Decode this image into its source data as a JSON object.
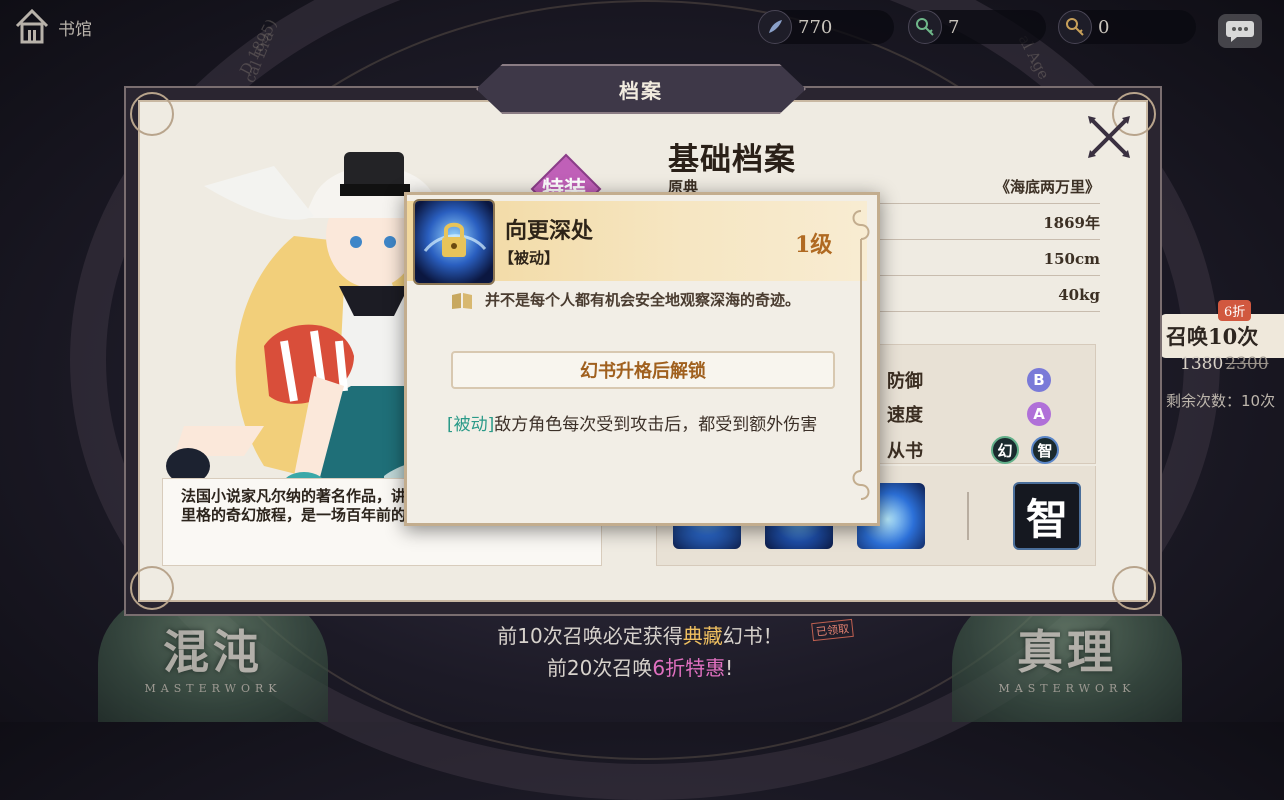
{
  "topbar": {
    "home_label": "书馆",
    "currencies": [
      {
        "icon": "feather-gem-icon",
        "value": "770"
      },
      {
        "icon": "key-icon",
        "value": "7"
      },
      {
        "icon": "golden-key-icon",
        "value": "0"
      }
    ]
  },
  "background": {
    "era_text_left": "cal Era",
    "era_text_left2": "D 1895)",
    "era_text_right": "al Age",
    "summon": {
      "label": "召唤10次",
      "discount": "6折",
      "price": "1380",
      "old_price": "2300",
      "remaining": "剩余次数：10次"
    },
    "banner_left": {
      "title": "混沌",
      "subtitle": "MASTERWORK"
    },
    "banner_right": {
      "title": "真理",
      "subtitle": "MASTERWORK"
    },
    "promo1_prefix": "前10次召唤必定获得",
    "promo1_highlight": "典藏",
    "promo1_suffix": "幻书！",
    "promo1_claimed": "已领取",
    "promo2_prefix": "前20次召唤",
    "promo2_highlight": "6折特惠",
    "promo2_suffix": "!"
  },
  "panel": {
    "title": "档案",
    "mark_label": "特装",
    "description": "法国小说家凡尔纳的著名作品，讲述乘坐潜艇在大洋中两万里格的奇幻旅程，是一场百年前的深海之梦。",
    "profile": {
      "heading": "基础档案",
      "rows": [
        {
          "label": "原典",
          "value": "《海底两万里》"
        },
        {
          "label": "",
          "value": "1869年"
        },
        {
          "label": "",
          "value": "150cm"
        },
        {
          "label": "",
          "value": "40kg"
        }
      ]
    },
    "stats": [
      {
        "label": "防御",
        "grade": "B",
        "color": "#7a7ad8"
      },
      {
        "label": "速度",
        "grade": "A",
        "color": "#b070d8"
      }
    ],
    "book_type": {
      "label": "从书",
      "badges": [
        "幻",
        "智"
      ]
    },
    "wisdom_badge": "智"
  },
  "popup": {
    "name": "向更深处",
    "type": "【被动】",
    "level": "1级",
    "flavor": "并不是每个人都有机会安全地观察深海的奇迹。",
    "unlock_label": "幻书升格后解锁",
    "effect_tag": "[被动]",
    "effect_text": "敌方角色每次受到攻击后，都受到额外伤害"
  },
  "colors": {
    "panel_bg": "#efebe2",
    "accent_gold": "#b06a22",
    "effect_teal": "#2a9a88",
    "promo_gold": "#f0c060",
    "promo_pink": "#e070c0"
  }
}
